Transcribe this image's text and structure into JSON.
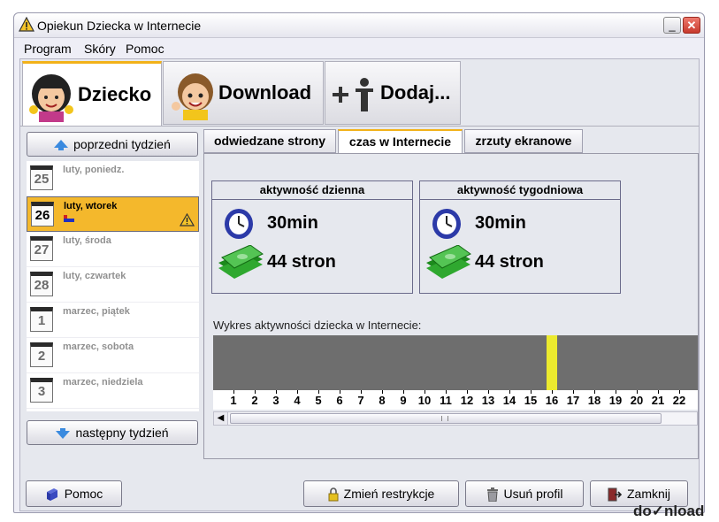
{
  "window": {
    "title": "Opiekun Dziecka w Internecie",
    "minimize_glyph": "_",
    "close_glyph": "✕"
  },
  "menu": [
    "Program",
    "Skóry",
    "Pomoc"
  ],
  "big_tabs": [
    {
      "label": "Dziecko",
      "icon": "child-girl-icon"
    },
    {
      "label": "Download",
      "icon": "child-boy-icon"
    },
    {
      "label": "Dodaj...",
      "icon": "add-person-icon"
    }
  ],
  "prev_week_label": "poprzedni tydzień",
  "next_week_label": "następny tydzień",
  "days": [
    {
      "num": "25",
      "label": "luty, poniedz."
    },
    {
      "num": "26",
      "label": "luty, wtorek",
      "selected": true,
      "warning": true
    },
    {
      "num": "27",
      "label": "luty, środa"
    },
    {
      "num": "28",
      "label": "luty, czwartek"
    },
    {
      "num": "1",
      "label": "marzec, piątek"
    },
    {
      "num": "2",
      "label": "marzec, sobota"
    },
    {
      "num": "3",
      "label": "marzec, niedziela"
    }
  ],
  "tabs": [
    "odwiedzane strony",
    "czas w Internecie",
    "zrzuty ekranowe"
  ],
  "daily": {
    "title": "aktywność dzienna",
    "time": "30min",
    "pages": "44 stron"
  },
  "weekly": {
    "title": "aktywność tygodniowa",
    "time": "30min",
    "pages": "44 stron"
  },
  "chart_title": "Wykres aktywności dziecka w Internecie:",
  "chart_data": {
    "type": "bar",
    "categories": [
      "1",
      "2",
      "3",
      "4",
      "5",
      "6",
      "7",
      "8",
      "9",
      "10",
      "11",
      "12",
      "13",
      "14",
      "15",
      "16",
      "17",
      "18",
      "19",
      "20",
      "21",
      "22"
    ],
    "active_hours": [
      "16"
    ]
  },
  "buttons": {
    "help": "Pomoc",
    "restrictions": "Zmień restrykcje",
    "delete": "Usuń profil",
    "close": "Zamknij"
  },
  "watermark": "do✓nload"
}
